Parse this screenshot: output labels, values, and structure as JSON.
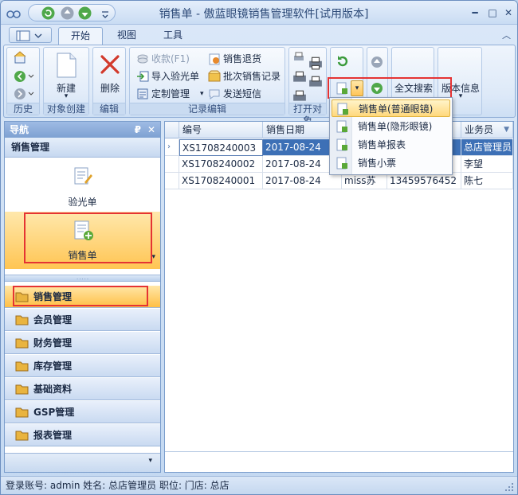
{
  "title": "销售单 - 傲蓝眼镜销售管理软件[试用版本]",
  "tabs": [
    {
      "label": "开始",
      "active": true
    },
    {
      "label": "视图",
      "active": false
    },
    {
      "label": "工具",
      "active": false
    }
  ],
  "ribbon": {
    "groups": {
      "history": "历史",
      "create": "对象创建",
      "edit": "编辑",
      "record": "记录编辑",
      "open": "打开对象"
    },
    "new_label": "新建",
    "delete_label": "删除",
    "receive_label": "收款(F1)",
    "import_label": "导入验光单",
    "custom_label": "定制管理",
    "return_label": "销售退货",
    "batch_label": "批次销售记录",
    "sms_label": "发送短信",
    "search_label": "全文搜索",
    "version_label": "版本信息"
  },
  "dropdown": {
    "items": [
      {
        "label": "销售单(普通眼镜)",
        "selected": true
      },
      {
        "label": "销售单(隐形眼镜)",
        "selected": false
      },
      {
        "label": "销售单报表",
        "selected": false
      },
      {
        "label": "销售小票",
        "selected": false
      }
    ]
  },
  "nav": {
    "header": "导航",
    "group_title": "销售管理",
    "items": [
      {
        "label": "验光单"
      },
      {
        "label": "销售单"
      }
    ],
    "categories": [
      {
        "label": "销售管理",
        "active": true
      },
      {
        "label": "会员管理",
        "active": false
      },
      {
        "label": "财务管理",
        "active": false
      },
      {
        "label": "库存管理",
        "active": false
      },
      {
        "label": "基础资料",
        "active": false
      },
      {
        "label": "GSP管理",
        "active": false
      },
      {
        "label": "报表管理",
        "active": false
      }
    ]
  },
  "grid": {
    "columns": [
      "编号",
      "销售日期",
      "",
      "",
      "业务员"
    ],
    "rows": [
      [
        "XS1708240003",
        "2017-08-24",
        "",
        "",
        "总店管理员"
      ],
      [
        "XS1708240002",
        "2017-08-24",
        "",
        "",
        "李望"
      ],
      [
        "XS1708240001",
        "2017-08-24",
        "miss苏",
        "13459576452",
        "陈七"
      ]
    ]
  },
  "status": {
    "text": "登录账号: admin   姓名: 总店管理员   职位:    门店: 总店"
  },
  "colors": {
    "accent": "#3d70b6",
    "highlight_box": "#e53333",
    "selected_item": "#ffd87c"
  }
}
